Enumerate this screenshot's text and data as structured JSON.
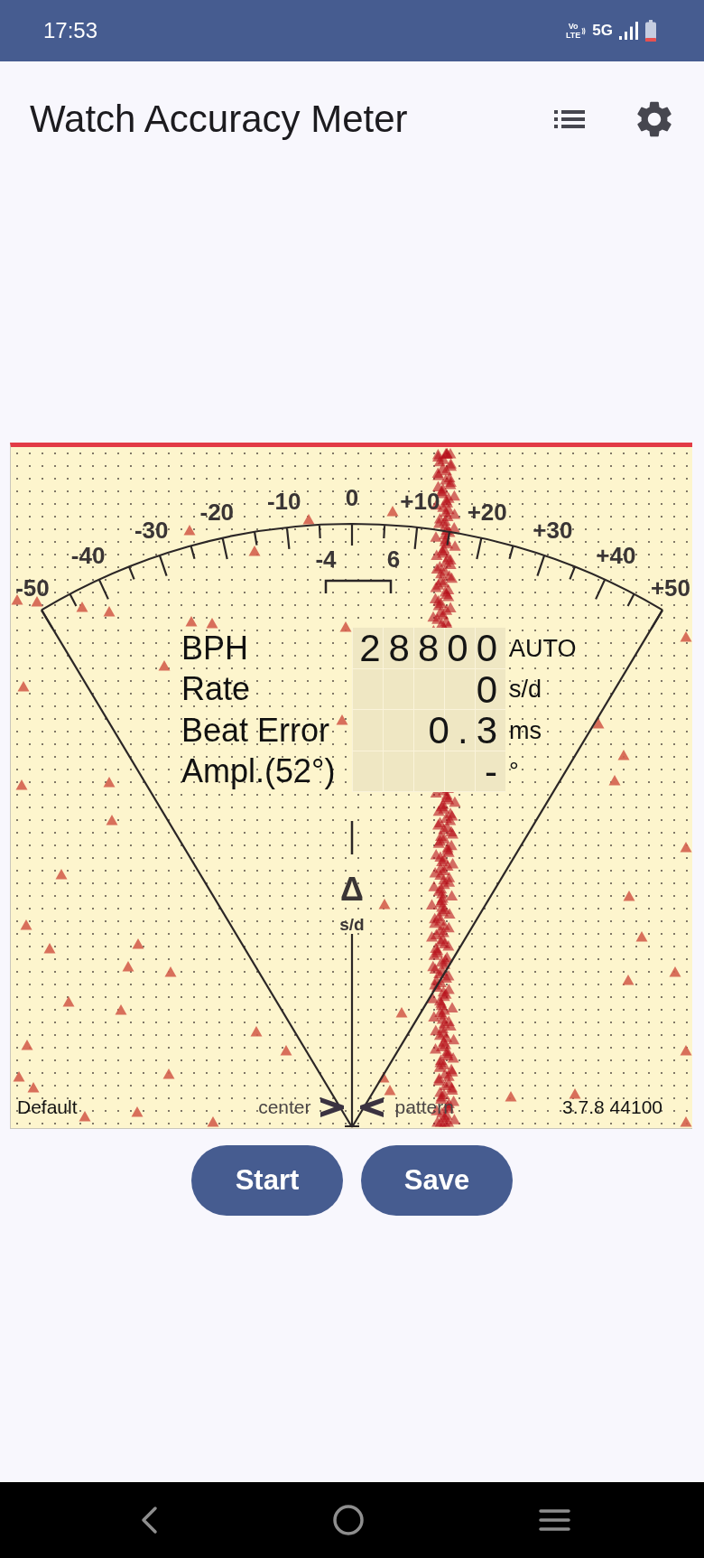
{
  "status_bar": {
    "time": "17:53",
    "volte_top": "Vo",
    "volte_bottom": "LTE",
    "network": "5G"
  },
  "app_bar": {
    "title": "Watch Accuracy Meter"
  },
  "meter": {
    "scale_labels": [
      "-50",
      "-40",
      "-30",
      "-20",
      "-10",
      "0",
      "+10",
      "+20",
      "+30",
      "+40",
      "+50"
    ],
    "range_labels": [
      "-4",
      "6"
    ],
    "delta_symbol": "Δ",
    "delta_unit": "s/d",
    "readings": [
      {
        "label": "BPH",
        "value": "28800",
        "unit": "AUTO"
      },
      {
        "label": "Rate",
        "value": "0",
        "unit": "s/d"
      },
      {
        "label": "Beat Error",
        "value": "0.3",
        "unit": "ms"
      },
      {
        "label": "Ampl.(52°)",
        "value": "-",
        "unit": "°"
      }
    ],
    "footer": {
      "profile": "Default",
      "left_hint": "center",
      "right_hint": "pattern",
      "version": "3.7.8 44100"
    }
  },
  "buttons": [
    {
      "label": "Start"
    },
    {
      "label": "Save"
    }
  ]
}
